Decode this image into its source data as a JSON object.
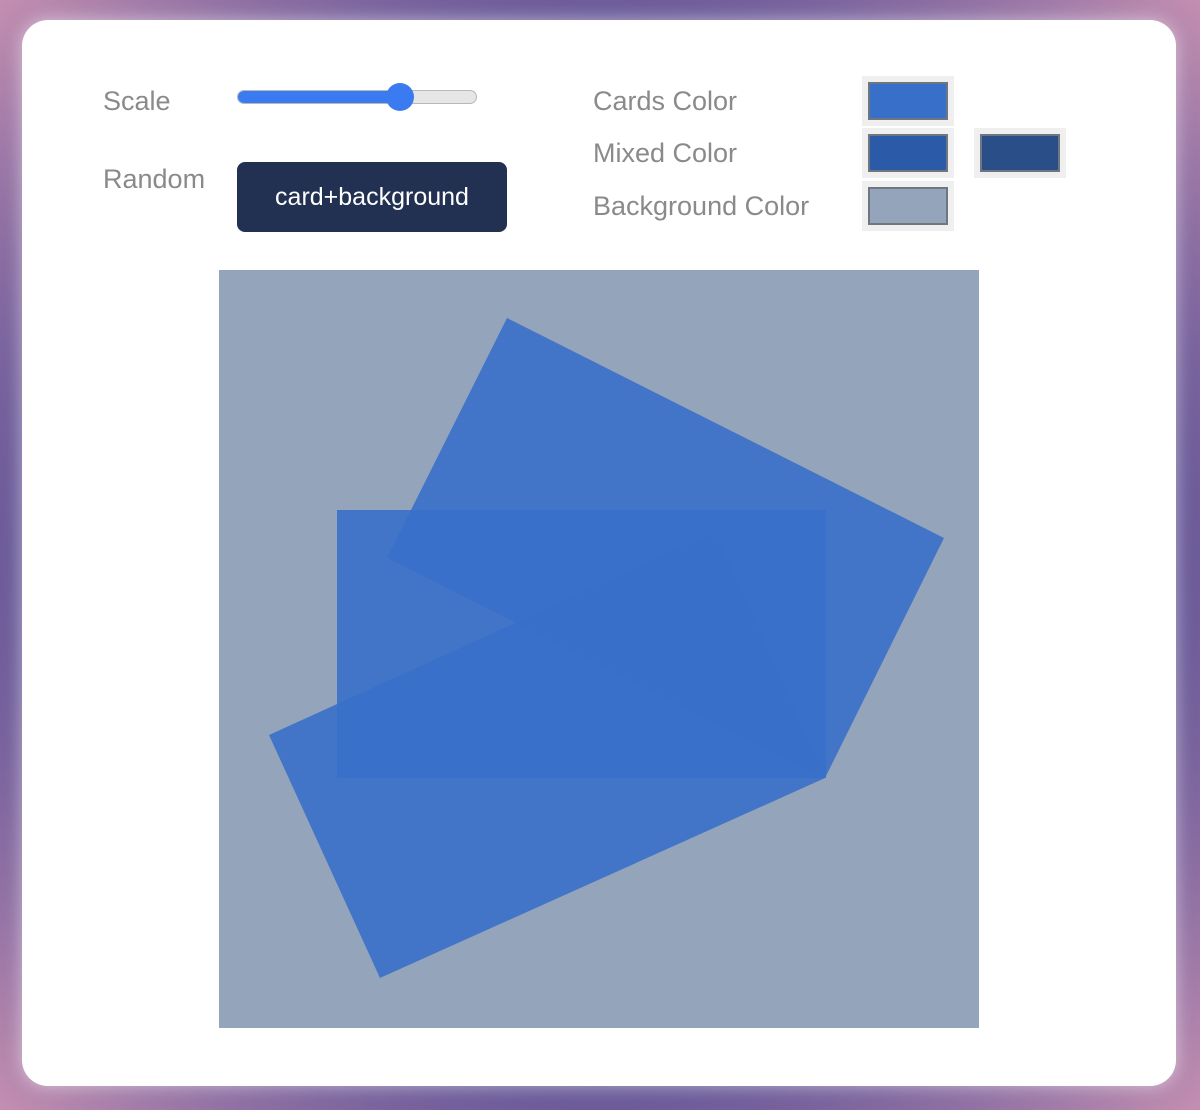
{
  "controls": {
    "scale_label": "Scale",
    "scale_value": 0.68,
    "random_label": "Random",
    "random_button": "card+background",
    "cards_color_label": "Cards Color",
    "mixed_color_label": "Mixed Color",
    "background_color_label": "Background Color"
  },
  "colors": {
    "cards": "#3870c9",
    "mixed": "#2b5ba8",
    "mixed_dark": "#2a4f88",
    "background": "#94a4bb",
    "slider_accent": "#3a7bf2",
    "button_bg": "#223052"
  }
}
